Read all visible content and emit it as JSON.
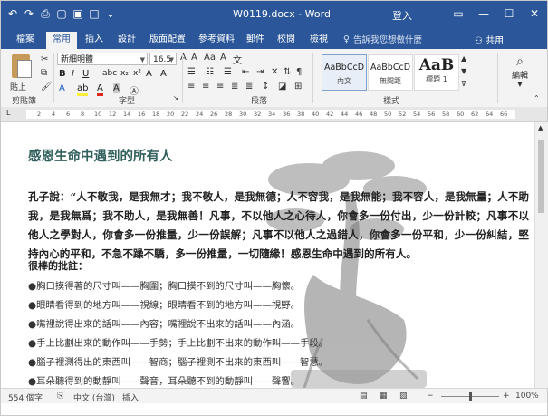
{
  "window": {
    "title": "W0119.docx - Word",
    "login": "登入",
    "restore_icon": "ribbon-display-icon"
  },
  "tabs": [
    {
      "label": "檔案"
    },
    {
      "label": "常用"
    },
    {
      "label": "插入"
    },
    {
      "label": "設計"
    },
    {
      "label": "版面配置"
    },
    {
      "label": "參考資料"
    },
    {
      "label": "郵件"
    },
    {
      "label": "校閱"
    },
    {
      "label": "檢視"
    }
  ],
  "tell_me": "告訴我您想做什麼",
  "share": "共用",
  "ribbon": {
    "paste": "貼上",
    "font_name": "新細明體",
    "font_size": "16.5",
    "groups": {
      "clipboard": "剪貼簿",
      "font": "字型",
      "paragraph": "段落",
      "styles": "樣式",
      "editing": "編輯"
    },
    "styles": [
      {
        "sample": "AaBbCcD",
        "name": "內文"
      },
      {
        "sample": "AaBbCcD",
        "name": "無間距"
      },
      {
        "sample": "AaB",
        "name": "標題 1"
      }
    ]
  },
  "document": {
    "heading": "感恩生命中遇到的所有人",
    "paragraph": "孔子說：“人不敬我，是我無才；我不敬人，是我無德；人不容我，是我無能；我不容人，是我無量；人不助我，是我無爲；我不助人，是我無善！凡事，不以他人之心待人，你會多一份付出，少一份計較；凡事不以他人之學對人，你會多一份推量，少一份誤解；凡事不以他人之過錯人，你會多一份平和，少一份糾結，堅持內心的平和，不急不躁不驕，多一份推量，一切隨緣！感恩生命中遇到的所有人。",
    "subheading": "很棒的批註：",
    "bullets": [
      "●胸口摸得著的尺寸叫——胸圍；胸口摸不到的尺寸叫——胸懷。",
      "●眼睛看得到的地方叫——視線；眼睛看不到的地方叫——視野。",
      "●嘴裡說得出來的話叫——內容；嘴裡說不出來的話叫——內涵。",
      "●手上比劃出來的動作叫——手勢；手上比劃不出來的動作叫——手段。",
      "●腦子裡測得出的東西叫——智商；腦子裡測不出來的東西叫——智慧。",
      "●耳朵聽得到的動靜叫——聲音，耳朵聽不到的動靜叫——聲響。"
    ]
  },
  "status": {
    "word_count": "554 個字",
    "language": "中文 (台灣)",
    "mode": "插入",
    "zoom": "100%"
  }
}
